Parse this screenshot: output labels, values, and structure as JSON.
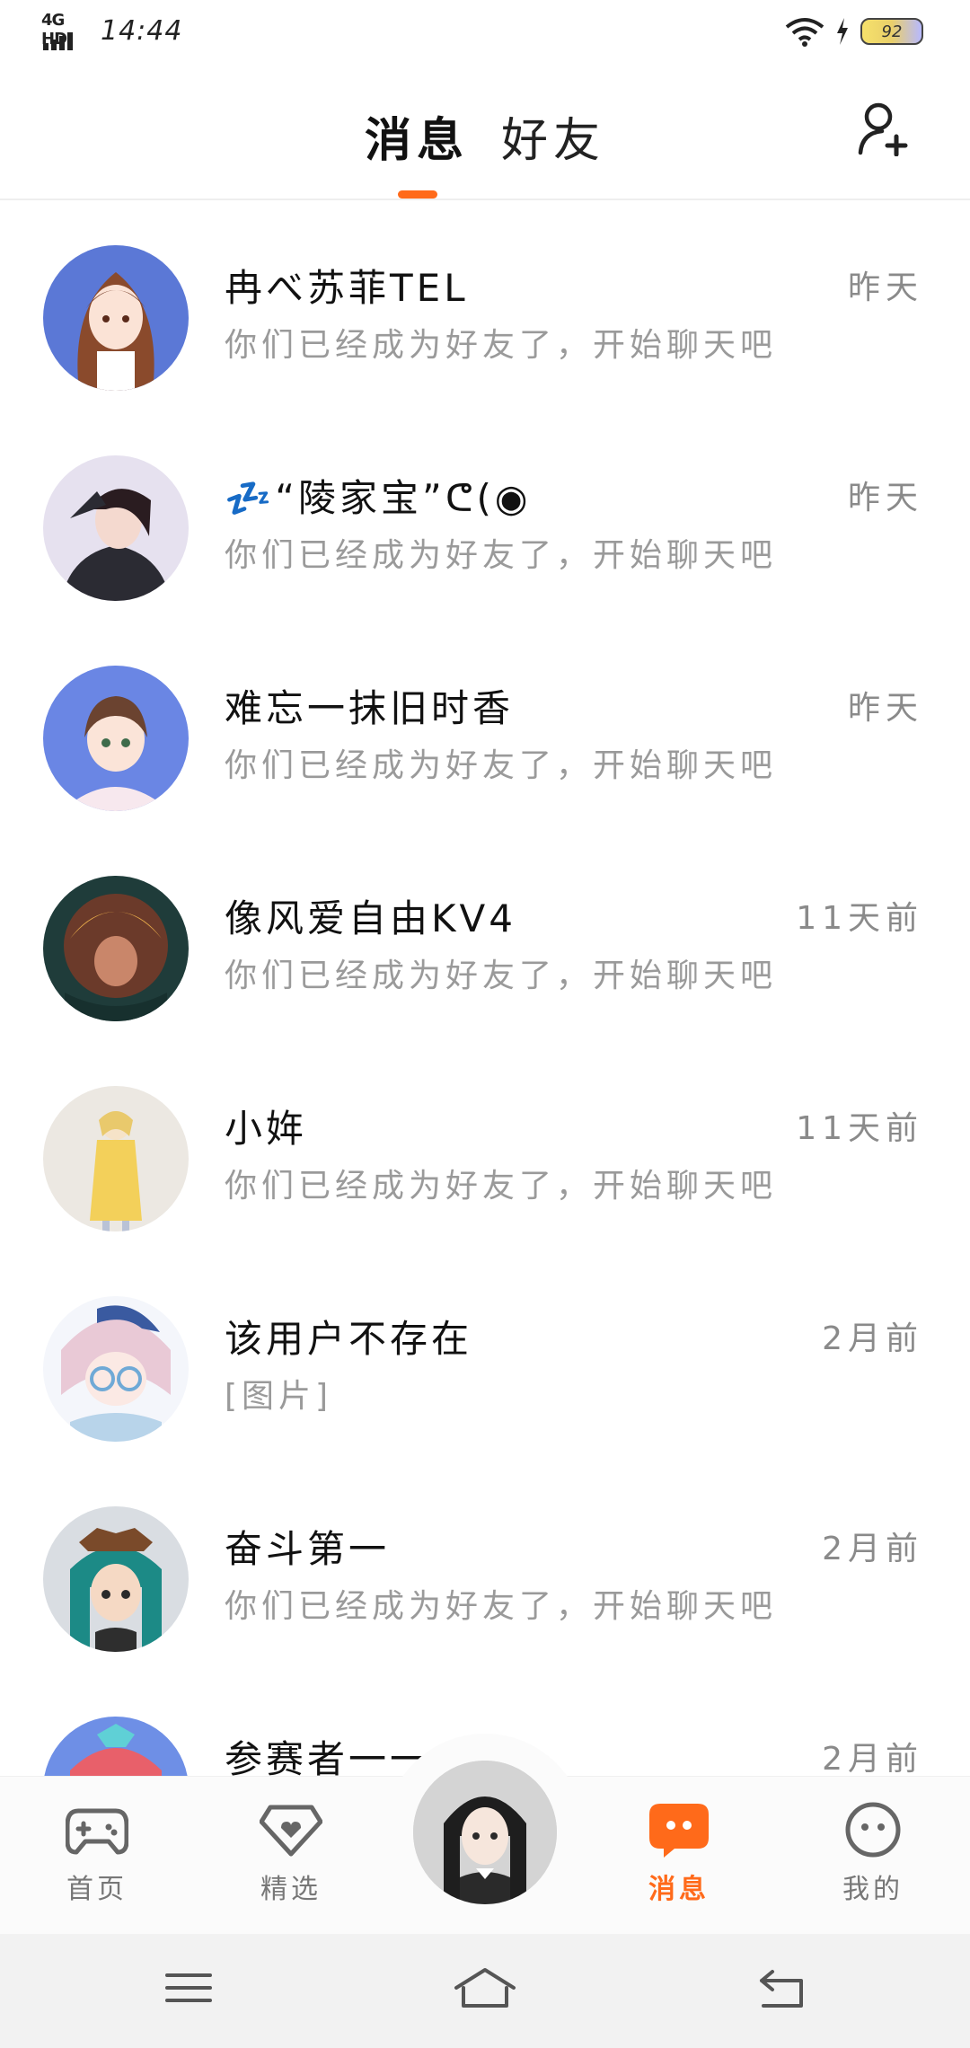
{
  "status_bar": {
    "network": "4G HD",
    "time": "14:44",
    "battery": "92",
    "icons": [
      "wifi-icon",
      "charging-icon",
      "battery-icon"
    ]
  },
  "header": {
    "tabs": [
      {
        "label": "消息",
        "active": true
      },
      {
        "label": "好友",
        "active": false
      }
    ],
    "add_friend_icon": "add-user-icon"
  },
  "conversations": [
    {
      "name": "冉べ苏菲TEL",
      "preview": "你们已经成为好友了，开始聊天吧",
      "time": "昨天"
    },
    {
      "name": "💤“陵家宝”ᕦ(◉",
      "preview": "你们已经成为好友了，开始聊天吧",
      "time": "昨天"
    },
    {
      "name": "难忘一抹旧时香",
      "preview": "你们已经成为好友了，开始聊天吧",
      "time": "昨天"
    },
    {
      "name": "像风爱自由KV4",
      "preview": "你们已经成为好友了，开始聊天吧",
      "time": "11天前"
    },
    {
      "name": "小姩",
      "preview": "你们已经成为好友了，开始聊天吧",
      "time": "11天前"
    },
    {
      "name": "该用户不存在",
      "preview": "[图片]",
      "time": "2月前"
    },
    {
      "name": "奋斗第一",
      "preview": "你们已经成为好友了，开始聊天吧",
      "time": "2月前"
    },
    {
      "name": "参赛者一一",
      "preview": "",
      "time": "2月前"
    }
  ],
  "bottom_nav": {
    "items": [
      {
        "label": "首页",
        "icon": "gamepad-icon"
      },
      {
        "label": "精选",
        "icon": "heart-shield-icon"
      },
      {
        "label": "消息",
        "icon": "chat-bubble-icon",
        "active": true
      },
      {
        "label": "我的",
        "icon": "face-icon"
      }
    ],
    "accent": "#ff6a1a"
  },
  "system_nav": [
    "menu-icon",
    "home-icon",
    "back-icon"
  ]
}
